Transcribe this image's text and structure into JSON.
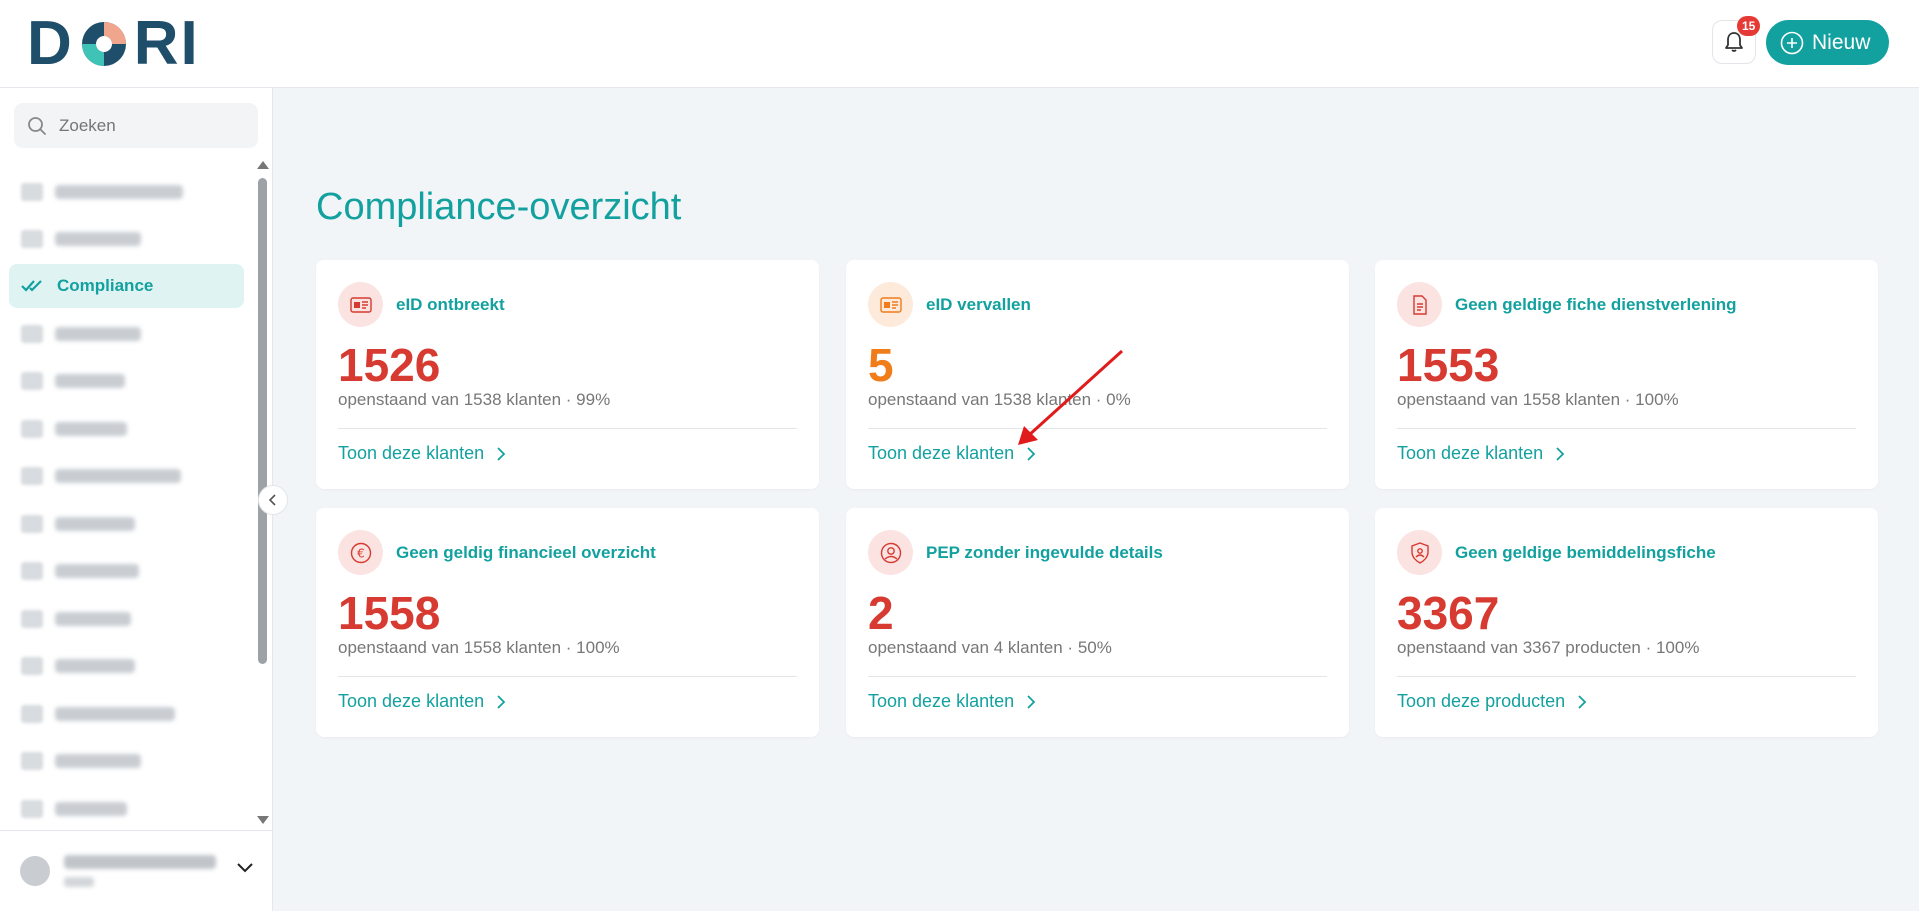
{
  "header": {
    "logo_text_left": "D",
    "logo_text_right": "RI",
    "notification_count": "15",
    "new_button_label": "Nieuw"
  },
  "sidebar": {
    "search_placeholder": "Zoeken",
    "items": [
      {
        "label": "",
        "blurred": true,
        "width": 128
      },
      {
        "label": "",
        "blurred": true,
        "width": 86
      },
      {
        "label": "Compliance",
        "blurred": false,
        "active": true
      },
      {
        "label": "",
        "blurred": true,
        "width": 86
      },
      {
        "label": "",
        "blurred": true,
        "width": 70
      },
      {
        "label": "",
        "blurred": true,
        "width": 72
      },
      {
        "label": "",
        "blurred": true,
        "width": 126
      },
      {
        "label": "",
        "blurred": true,
        "width": 80
      },
      {
        "label": "",
        "blurred": true,
        "width": 84
      },
      {
        "label": "",
        "blurred": true,
        "width": 76
      },
      {
        "label": "",
        "blurred": true,
        "width": 80
      },
      {
        "label": "",
        "blurred": true,
        "width": 120
      },
      {
        "label": "",
        "blurred": true,
        "width": 86
      },
      {
        "label": "",
        "blurred": true,
        "width": 72
      }
    ]
  },
  "main": {
    "title": "Compliance-overzicht",
    "cards": [
      {
        "title": "eID ontbreekt",
        "number": "1526",
        "number_color": "#d63a31",
        "subtitle": "openstaand van 1538 klanten · 99%",
        "link": "Toon deze klanten",
        "icon": "id-card-icon",
        "icon_bg": "#fbe3e1",
        "icon_color": "#d63a31"
      },
      {
        "title": "eID vervallen",
        "number": "5",
        "number_color": "#f07c1a",
        "subtitle": "openstaand van 1538 klanten · 0%",
        "link": "Toon deze klanten",
        "icon": "id-card-icon",
        "icon_bg": "#fdeadb",
        "icon_color": "#f07c1a"
      },
      {
        "title": "Geen geldige fiche dienstverlening",
        "number": "1553",
        "number_color": "#d63a31",
        "subtitle": "openstaand van 1558 klanten · 100%",
        "link": "Toon deze klanten",
        "icon": "document-icon",
        "icon_bg": "#fbe3e1",
        "icon_color": "#d63a31"
      },
      {
        "title": "Geen geldig financieel overzicht",
        "number": "1558",
        "number_color": "#d63a31",
        "subtitle": "openstaand van 1558 klanten · 100%",
        "link": "Toon deze klanten",
        "icon": "euro-icon",
        "icon_bg": "#fbe3e1",
        "icon_color": "#d63a31"
      },
      {
        "title": "PEP zonder ingevulde details",
        "number": "2",
        "number_color": "#d63a31",
        "subtitle": "openstaand van 4 klanten · 50%",
        "link": "Toon deze klanten",
        "icon": "user-circle-icon",
        "icon_bg": "#fbe3e1",
        "icon_color": "#d63a31"
      },
      {
        "title": "Geen geldige bemiddelingsfiche",
        "number": "3367",
        "number_color": "#d63a31",
        "subtitle": "openstaand van 3367 producten · 100%",
        "link": "Toon deze producten",
        "icon": "shield-icon",
        "icon_bg": "#fbe3e1",
        "icon_color": "#d63a31"
      }
    ]
  },
  "colors": {
    "accent": "#13a1a0",
    "logo_dark": "#1f4e6a",
    "danger": "#d63a31",
    "warning": "#f07c1a",
    "annotation_arrow": "#e01b1b"
  }
}
